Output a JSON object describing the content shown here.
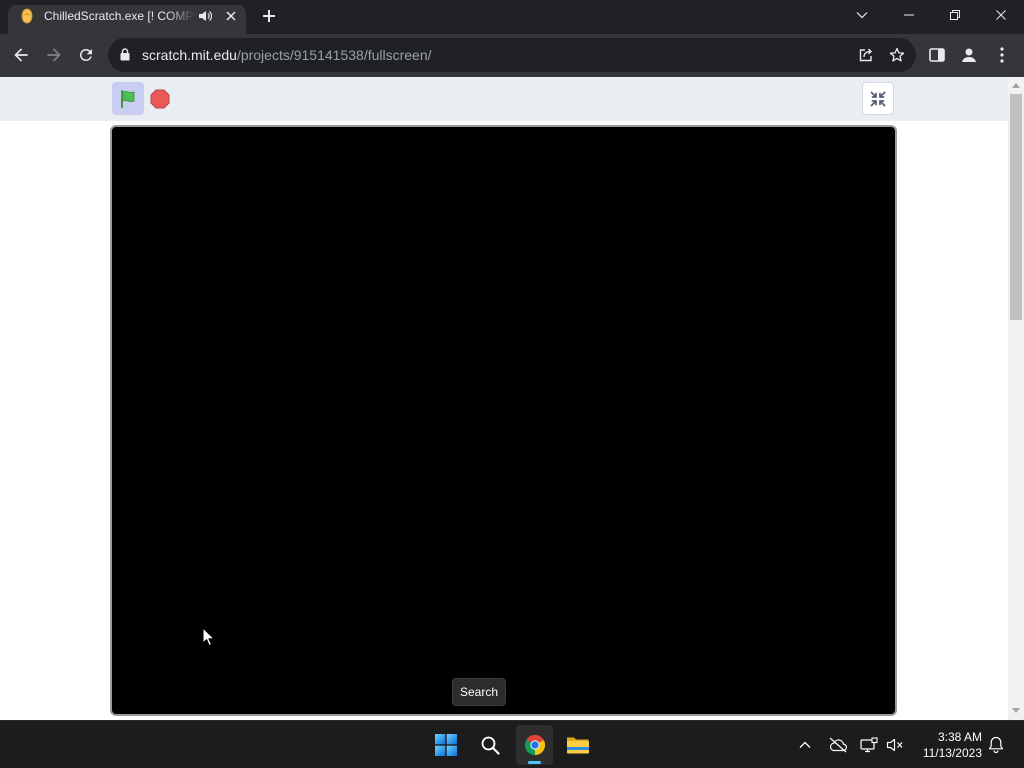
{
  "browser": {
    "tab": {
      "title": "ChilledScratch.exe [! COMPL",
      "favicon": "scratch-favicon",
      "audio_icon": "speaker-icon",
      "close_icon": "close-icon"
    },
    "new_tab_icon": "plus-icon",
    "window_controls": [
      "chevron-down-icon",
      "minimize-icon",
      "restore-icon",
      "close-icon"
    ],
    "toolbar": {
      "nav_icons": [
        "back-arrow-icon",
        "forward-arrow-icon",
        "reload-icon"
      ],
      "address": {
        "lock_icon": "lock-icon",
        "host": "scratch.mit.edu",
        "path": "/projects/915141538/fullscreen/"
      },
      "address_actions": [
        "share-icon",
        "star-icon"
      ],
      "right_icons": [
        "side-panel-icon",
        "profile-icon",
        "menu-kebab-icon"
      ]
    }
  },
  "scratch_player": {
    "controls": [
      "green-flag-icon",
      "stop-sign-icon"
    ],
    "fullscreen_button_icon": "exit-fullscreen-icon",
    "stage_color": "#000000"
  },
  "taskbar": {
    "pinned": [
      "windows-start-icon",
      "search-icon",
      "chrome-icon",
      "file-explorer-icon"
    ],
    "tooltip": "Search",
    "tray_icons": [
      "chevron-up-icon",
      "cloud-off-icon",
      "network-icon",
      "volume-muted-icon"
    ],
    "clock": {
      "time": "3:38 AM",
      "date": "11/13/2023"
    },
    "notification_icon": "bell-icon"
  },
  "colors": {
    "tab_strip": "#202124",
    "toolbar": "#35363a",
    "omnibox": "#202124",
    "scratch_header": "#e9eef2",
    "green_flag": "#4cbf56",
    "stop_sign": "#ec5959",
    "taskbar": "#1c1c1c",
    "accent": "#4cc2ff"
  }
}
